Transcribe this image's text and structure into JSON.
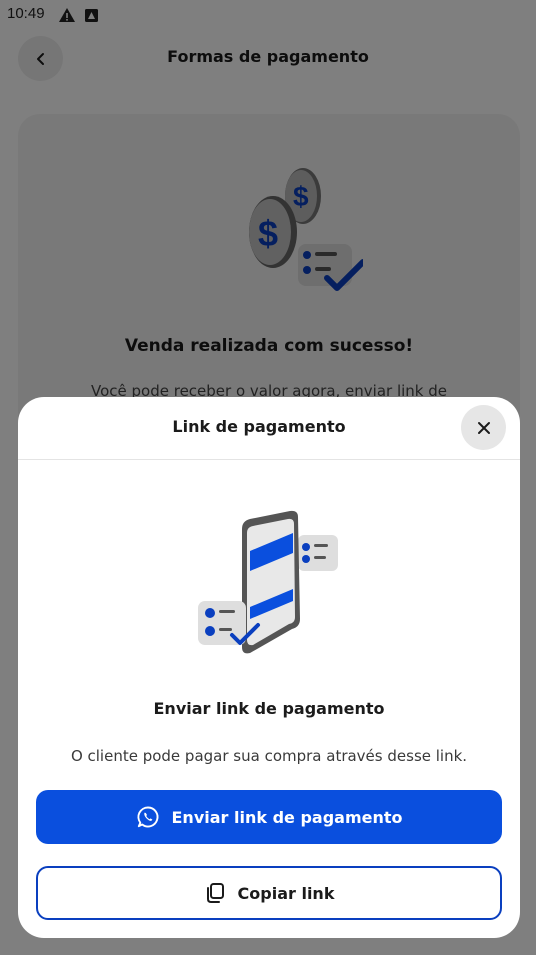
{
  "status_bar": {
    "time": "10:49",
    "icons": [
      "warning-icon",
      "notification-icon"
    ]
  },
  "app_bar": {
    "title": "Formas de pagamento",
    "back_icon": "chevron-left-icon"
  },
  "success_card": {
    "illustration": "coins-checklist-illustration",
    "title": "Venda realizada com sucesso!",
    "description": "Você pode receber o valor agora, enviar link de"
  },
  "sheet": {
    "title": "Link de pagamento",
    "close_icon": "close-icon",
    "illustration": "phone-checklist-illustration",
    "heading": "Enviar link de pagamento",
    "description": "O cliente pode pagar sua compra através desse link.",
    "primary_button": {
      "label": "Enviar link de pagamento",
      "icon": "whatsapp-icon"
    },
    "secondary_button": {
      "label": "Copiar link",
      "icon": "copy-icon"
    }
  },
  "colors": {
    "brand_blue": "#0a4fde",
    "overlay": "rgba(0,0,0,0.5)"
  }
}
